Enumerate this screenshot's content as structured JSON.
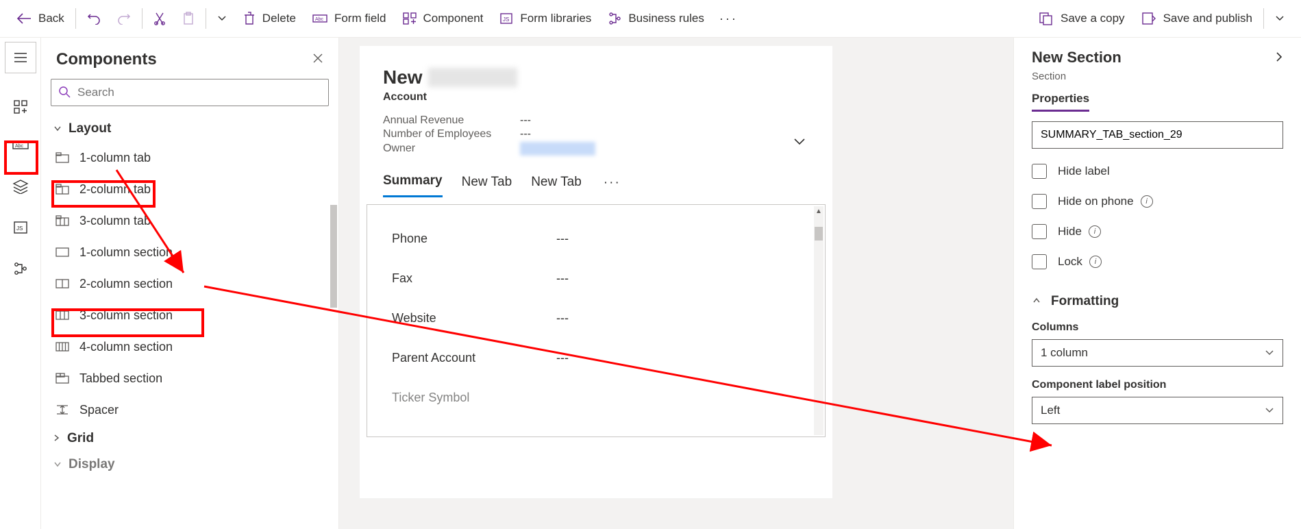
{
  "toolbar": {
    "back": "Back",
    "delete": "Delete",
    "form_field": "Form field",
    "component": "Component",
    "form_libraries": "Form libraries",
    "business_rules": "Business rules",
    "save_copy": "Save a copy",
    "save_publish": "Save and publish"
  },
  "components": {
    "title": "Components",
    "search_placeholder": "Search",
    "group_layout": "Layout",
    "items": {
      "col1_tab": "1-column tab",
      "col2_tab": "2-column tab",
      "col3_tab": "3-column tab",
      "col1_section": "1-column section",
      "col2_section": "2-column section",
      "col3_section": "3-column section",
      "col4_section": "4-column section",
      "tabbed_section": "Tabbed section",
      "spacer": "Spacer"
    },
    "group_grid": "Grid",
    "group_display": "Display"
  },
  "form": {
    "title_prefix": "New",
    "entity": "Account",
    "header_fields": {
      "annual_revenue_label": "Annual Revenue",
      "annual_revenue_value": "---",
      "num_employees_label": "Number of Employees",
      "num_employees_value": "---",
      "owner_label": "Owner"
    },
    "tabs": {
      "summary": "Summary",
      "newtab1": "New Tab",
      "newtab2": "New Tab"
    },
    "body_fields": {
      "phone_label": "Phone",
      "phone_value": "---",
      "fax_label": "Fax",
      "fax_value": "---",
      "website_label": "Website",
      "website_value": "---",
      "parent_label": "Parent Account",
      "parent_value": "---",
      "ticker_label": "Ticker Symbol"
    }
  },
  "right": {
    "title": "New Section",
    "subtitle": "Section",
    "properties_tab": "Properties",
    "name_value": "SUMMARY_TAB_section_29",
    "checks": {
      "hide_label": "Hide label",
      "hide_on_phone": "Hide on phone",
      "hide": "Hide",
      "lock": "Lock"
    },
    "formatting": "Formatting",
    "columns_label": "Columns",
    "columns_value": "1 column",
    "label_pos_label": "Component label position",
    "label_pos_value": "Left"
  }
}
